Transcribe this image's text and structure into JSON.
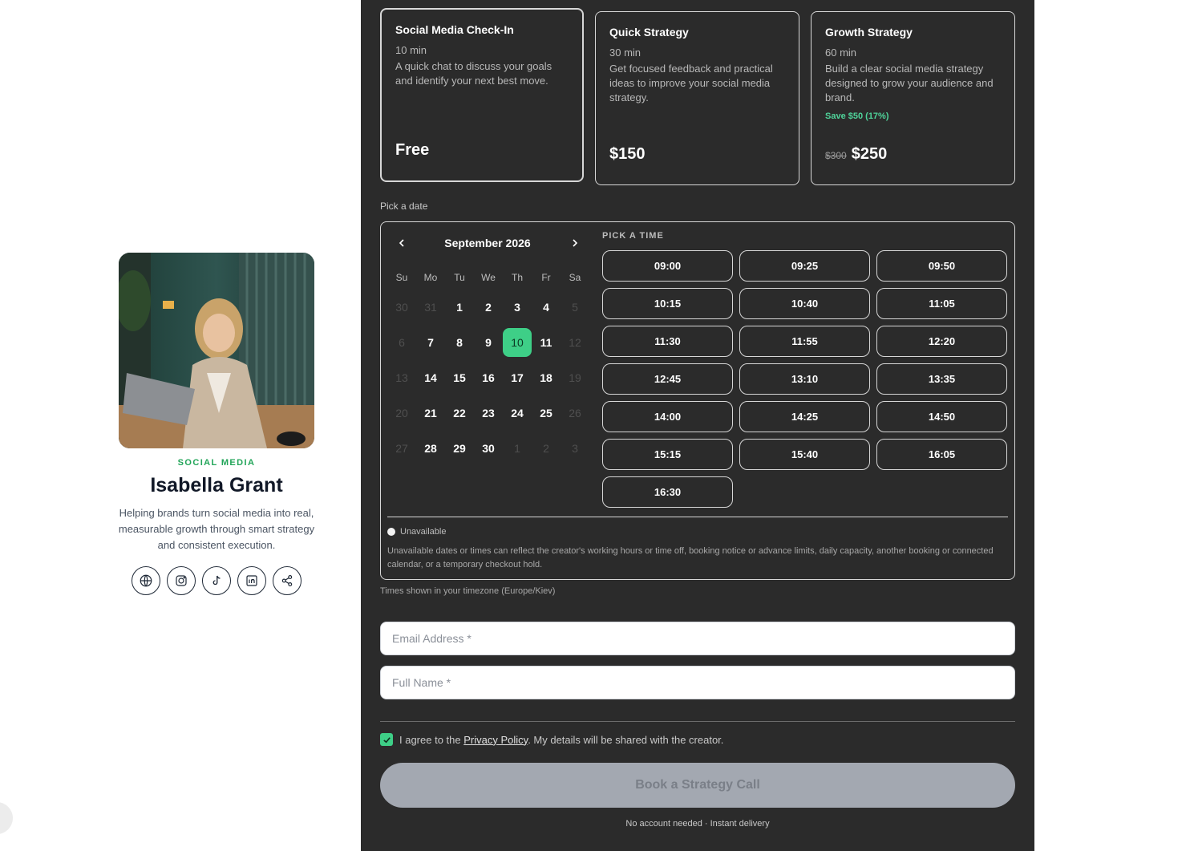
{
  "profile": {
    "category": "SOCIAL MEDIA",
    "name": "Isabella Grant",
    "bio": "Helping brands turn social media into real, measurable growth through smart strategy and consistent execution.",
    "social_icons": [
      "globe-icon",
      "instagram-icon",
      "tiktok-icon",
      "linkedin-icon",
      "share-icon"
    ]
  },
  "offers": [
    {
      "title": "Social Media Check-In",
      "duration": "10 min",
      "description": "A quick chat to discuss your goals and identify your next best move.",
      "price": "Free",
      "selected": true
    },
    {
      "title": "Quick Strategy",
      "duration": "30 min",
      "description": "Get focused feedback and practical ideas to improve your social media strategy.",
      "price": "$150"
    },
    {
      "title": "Growth Strategy",
      "duration": "60 min",
      "description": "Build a clear social media strategy designed to grow your audience and brand.",
      "save": "Save $50 (17%)",
      "old_price": "$300",
      "price": "$250"
    }
  ],
  "calendar": {
    "pick_date_label": "Pick a date",
    "month": "September 2026",
    "weekdays": [
      "Su",
      "Mo",
      "Tu",
      "We",
      "Th",
      "Fr",
      "Sa"
    ],
    "weeks": [
      [
        "30",
        "31",
        "1",
        "2",
        "3",
        "4",
        "5"
      ],
      [
        "6",
        "7",
        "8",
        "9",
        "10",
        "11",
        "12"
      ],
      [
        "13",
        "14",
        "15",
        "16",
        "17",
        "18",
        "19"
      ],
      [
        "20",
        "21",
        "22",
        "23",
        "24",
        "25",
        "26"
      ],
      [
        "27",
        "28",
        "29",
        "30",
        "1",
        "2",
        "3"
      ]
    ],
    "selected_day": "10",
    "pick_time_label": "PICK A TIME",
    "times": [
      "09:00",
      "09:25",
      "09:50",
      "10:15",
      "10:40",
      "11:05",
      "11:30",
      "11:55",
      "12:20",
      "12:45",
      "13:10",
      "13:35",
      "14:00",
      "14:25",
      "14:50",
      "15:15",
      "15:40",
      "16:05",
      "16:30"
    ],
    "legend_unavailable": "Unavailable",
    "note": "Unavailable dates or times can reflect the creator's working hours or time off, booking notice or advance limits, daily capacity, another booking or connected calendar, or a temporary checkout hold.",
    "timezone": "Times shown in your timezone (Europe/Kiev)"
  },
  "form": {
    "email_placeholder": "Email Address *",
    "name_placeholder": "Full Name *",
    "agree_prefix": "I agree to the ",
    "privacy_link": "Privacy Policy",
    "agree_suffix": ". My details will be shared with the creator.",
    "submit_label": "Book a Strategy Call",
    "footer": "No account needed · Instant delivery"
  }
}
